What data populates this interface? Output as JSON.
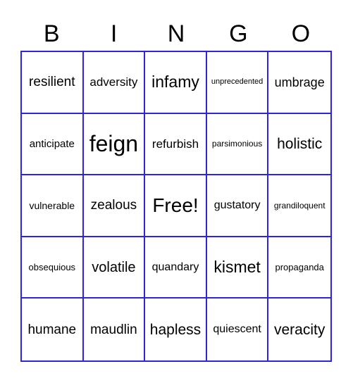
{
  "header": {
    "letters": [
      "B",
      "I",
      "N",
      "G",
      "O"
    ]
  },
  "board": {
    "border_color": "#2f25d8",
    "rows": [
      [
        "resilient",
        "adversity",
        "infamy",
        "unprecedented",
        "umbrage"
      ],
      [
        "anticipate",
        "feign",
        "refurbish",
        "parsimonious",
        "holistic"
      ],
      [
        "vulnerable",
        "zealous",
        "Free!",
        "gustatory",
        "grandiloquent"
      ],
      [
        "obsequious",
        "volatile",
        "quandary",
        "kismet",
        "propaganda"
      ],
      [
        "humane",
        "maudlin",
        "hapless",
        "quiescent",
        "veracity"
      ]
    ],
    "free_space": "Free!"
  }
}
